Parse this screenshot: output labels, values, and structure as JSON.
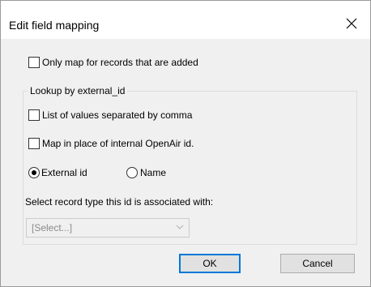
{
  "dialog": {
    "title": "Edit field mapping",
    "close_icon": "close-icon"
  },
  "options": {
    "only_added_label": "Only map for records that are added",
    "only_added_checked": false
  },
  "lookup": {
    "group_title": "Lookup by external_id",
    "list_label": "List of values separated by comma",
    "list_checked": false,
    "map_inplace_label": "Map in place of internal OpenAir id.",
    "map_inplace_checked": false,
    "radio_external_label": "External id",
    "radio_name_label": "Name",
    "radio_selected": "External id",
    "record_type_label": "Select record type this id is associated with:",
    "record_type_value": "[Select...]",
    "record_type_disabled": true
  },
  "buttons": {
    "ok_label": "OK",
    "cancel_label": "Cancel"
  }
}
